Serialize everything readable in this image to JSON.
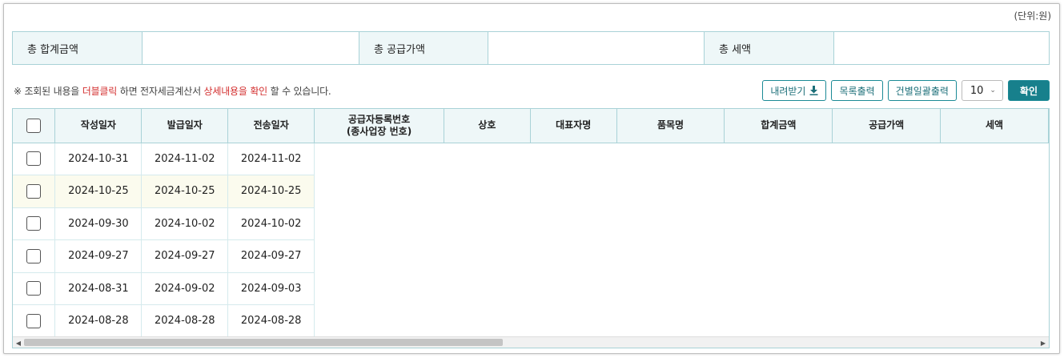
{
  "unit_label": "(단위:원)",
  "summary": {
    "total_label": "총 합계금액",
    "supply_label": "총 공급가액",
    "tax_label": "총 세액"
  },
  "notice": {
    "prefix": "※ 조회된 내용을 ",
    "highlight1": "더블클릭",
    "middle": " 하면 전자세금계산서 ",
    "highlight2": "상세내용을 확인",
    "suffix": " 할 수 있습니다."
  },
  "toolbar": {
    "download_label": "내려받기",
    "list_print_label": "목록출력",
    "batch_print_label": "건별일괄출력",
    "page_size": "10",
    "confirm_label": "확인"
  },
  "table": {
    "columns": [
      "작성일자",
      "발급일자",
      "전송일자",
      "공급자등록번호\n(종사업장 번호)",
      "상호",
      "대표자명",
      "품목명",
      "합계금액",
      "공급가액",
      "세액"
    ],
    "rows": [
      [
        "2024-10-31",
        "2024-11-02",
        "2024-11-02"
      ],
      [
        "2024-10-25",
        "2024-10-25",
        "2024-10-25"
      ],
      [
        "2024-09-30",
        "2024-10-02",
        "2024-10-02"
      ],
      [
        "2024-09-27",
        "2024-09-27",
        "2024-09-27"
      ],
      [
        "2024-08-31",
        "2024-09-02",
        "2024-09-03"
      ],
      [
        "2024-08-28",
        "2024-08-28",
        "2024-08-28"
      ]
    ]
  },
  "colors": {
    "accent": "#17808c",
    "header_bg": "#eef7f8",
    "border": "#a9d2d7",
    "highlight_text": "#d32f2f"
  }
}
